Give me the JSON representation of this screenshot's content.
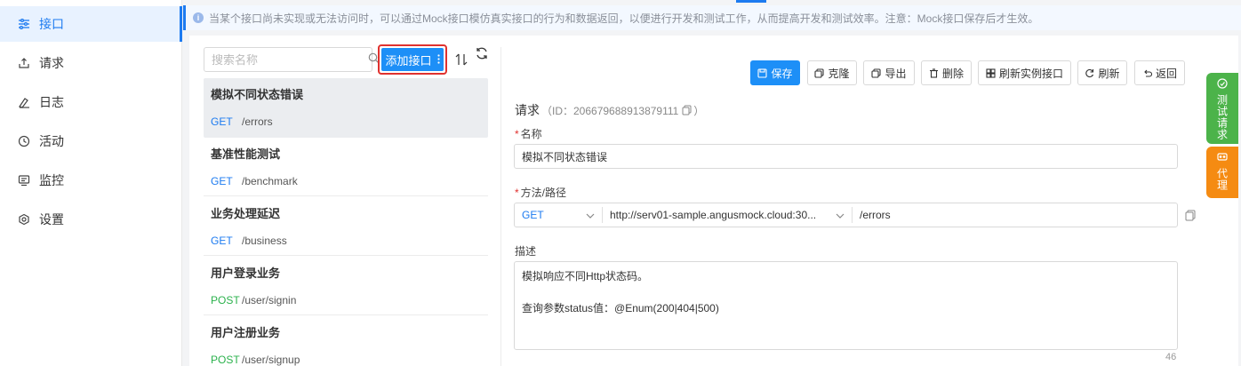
{
  "nav": {
    "items": [
      {
        "label": "接口",
        "icon": "api-icon",
        "active": true
      },
      {
        "label": "请求",
        "icon": "upload-icon",
        "active": false
      },
      {
        "label": "日志",
        "icon": "log-icon",
        "active": false
      },
      {
        "label": "活动",
        "icon": "clock-icon",
        "active": false
      },
      {
        "label": "监控",
        "icon": "monitor-icon",
        "active": false
      },
      {
        "label": "设置",
        "icon": "settings-icon",
        "active": false
      }
    ]
  },
  "info": {
    "text": "当某个接口尚未实现或无法访问时，可以通过Mock接口模仿真实接口的行为和数据返回，以便进行开发和测试工作，从而提高开发和测试效率。注意：Mock接口保存后才生效。"
  },
  "list": {
    "search_placeholder": "搜索名称",
    "add_label": "添加接口",
    "items": [
      {
        "title": "模拟不同状态错误",
        "method": "GET",
        "path": "/errors",
        "selected": true
      },
      {
        "title": "基准性能测试",
        "method": "GET",
        "path": "/benchmark",
        "selected": false
      },
      {
        "title": "业务处理延迟",
        "method": "GET",
        "path": "/business",
        "selected": false
      },
      {
        "title": "用户登录业务",
        "method": "POST",
        "path": "/user/signin",
        "selected": false
      },
      {
        "title": "用户注册业务",
        "method": "POST",
        "path": "/user/signup",
        "selected": false
      }
    ]
  },
  "toolbar": {
    "save": "保存",
    "clone": "克隆",
    "export": "导出",
    "delete": "删除",
    "refresh_instance": "刷新实例接口",
    "refresh": "刷新",
    "back": "返回"
  },
  "form": {
    "title": "请求",
    "id_text": "（ID：206679688913879111",
    "id_close": "）",
    "name_label": "名称",
    "name_value": "模拟不同状态错误",
    "method_label": "方法/路径",
    "method_value": "GET",
    "host_value": "http://serv01-sample.angusmock.cloud:30...",
    "path_value": "/errors",
    "desc_label": "描述",
    "desc_line1": "模拟响应不同Http状态码。",
    "desc_line2": "查询参数status值：@Enum(200|404|500)",
    "desc_count": "46"
  },
  "side": {
    "test_request": "测试请求",
    "proxy": "代理"
  },
  "colors": {
    "accent": "#1d8ff7",
    "get": "#1d7bf0",
    "post": "#2bb24c",
    "test_tab": "#4cb34a",
    "proxy_tab": "#f58b12",
    "highlight_border": "#e0312e"
  }
}
